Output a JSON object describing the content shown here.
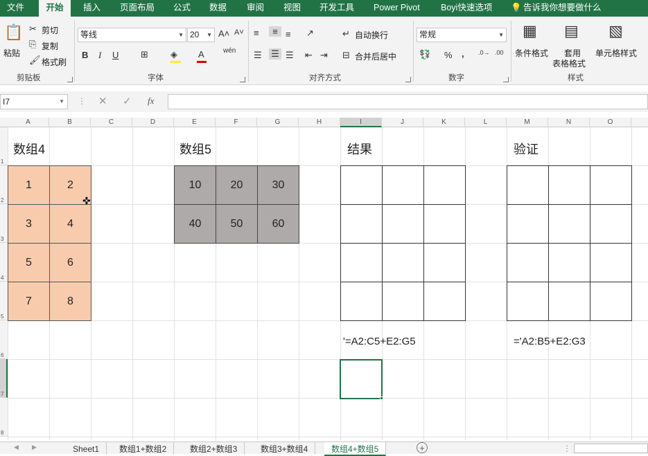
{
  "menu": {
    "file": "文件",
    "home": "开始",
    "insert": "插入",
    "layout": "页面布局",
    "formulas": "公式",
    "data": "数据",
    "review": "审阅",
    "view": "视图",
    "developer": "开发工具",
    "powerpivot": "Power Pivot",
    "boyi": "Boyi快速选项",
    "tell_me": "告诉我你想要做什么"
  },
  "ribbon": {
    "paste": "粘贴",
    "cut": "剪切",
    "copy": "复制",
    "format_painter": "格式刷",
    "clipboard_group": "剪贴板",
    "font_name": "等线",
    "font_size": "20",
    "font_group": "字体",
    "wrap_text": "自动换行",
    "merge_center": "合并后居中",
    "align_group": "对齐方式",
    "number_format": "常规",
    "number_group": "数字",
    "cond_format": "条件格式",
    "format_table_1": "套用",
    "format_table_2": "表格格式",
    "cell_styles": "单元格样式",
    "styles_group": "样式",
    "bold": "B",
    "italic": "I",
    "underline": "U",
    "percent": "%",
    "comma": ","
  },
  "formula_bar": {
    "name_box": "I7",
    "fx": "fx"
  },
  "columns": [
    "A",
    "B",
    "C",
    "D",
    "E",
    "F",
    "G",
    "H",
    "I",
    "J",
    "K",
    "L",
    "M",
    "N",
    "O"
  ],
  "rows": [
    "1",
    "2",
    "3",
    "4",
    "5",
    "6",
    "7",
    "8"
  ],
  "sheet": {
    "label_array4": "数组4",
    "label_array5": "数组5",
    "label_result": "结果",
    "label_verify": "验证",
    "array4": [
      "1",
      "2",
      "3",
      "4",
      "5",
      "6",
      "7",
      "8"
    ],
    "array5": [
      "10",
      "20",
      "30",
      "40",
      "50",
      "60"
    ],
    "note_result": "'=A2:C5+E2:G5",
    "note_verify": "='A2:B5+E2:G3"
  },
  "tabs": [
    "Sheet1",
    "数组1+数组2",
    "数组2+数组3",
    "数组3+数组4",
    "数组4+数组5"
  ],
  "colors": {
    "excel_green": "#217346",
    "peach": "#f8cbad",
    "gray": "#aeaaaa"
  }
}
